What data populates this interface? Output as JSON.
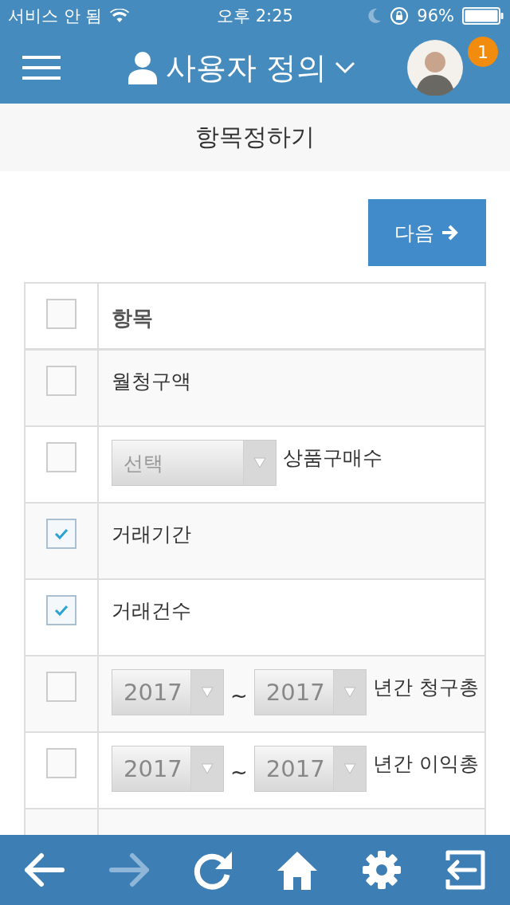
{
  "status_bar": {
    "carrier": "서비스 안 됨",
    "time": "오후 2:25",
    "battery": "96%"
  },
  "header": {
    "title": "사용자 정의",
    "badge": "1"
  },
  "subheader": {
    "title": "항목정하기"
  },
  "next_button": {
    "label": "다음"
  },
  "table": {
    "header": {
      "label": "항목",
      "checked": false
    },
    "rows": [
      {
        "kind": "plain",
        "label": "월청구액",
        "checked": false
      },
      {
        "kind": "select",
        "select": "선택",
        "label": "상품구매수",
        "checked": false
      },
      {
        "kind": "plain",
        "label": "거래기간",
        "checked": true
      },
      {
        "kind": "plain",
        "label": "거래건수",
        "checked": true
      },
      {
        "kind": "range",
        "from": "2017",
        "separator": "~",
        "to": "2017",
        "label": "년간 청구총",
        "checked": false
      },
      {
        "kind": "range",
        "from": "2017",
        "separator": "~",
        "to": "2017",
        "label": "년간 이익총",
        "checked": false
      }
    ]
  },
  "toolbar": [
    {
      "kind": "back",
      "disabled": false
    },
    {
      "kind": "forward",
      "disabled": true
    },
    {
      "kind": "refresh",
      "disabled": false
    },
    {
      "kind": "home",
      "disabled": false
    },
    {
      "kind": "settings",
      "disabled": false
    },
    {
      "kind": "logout",
      "disabled": false
    }
  ]
}
